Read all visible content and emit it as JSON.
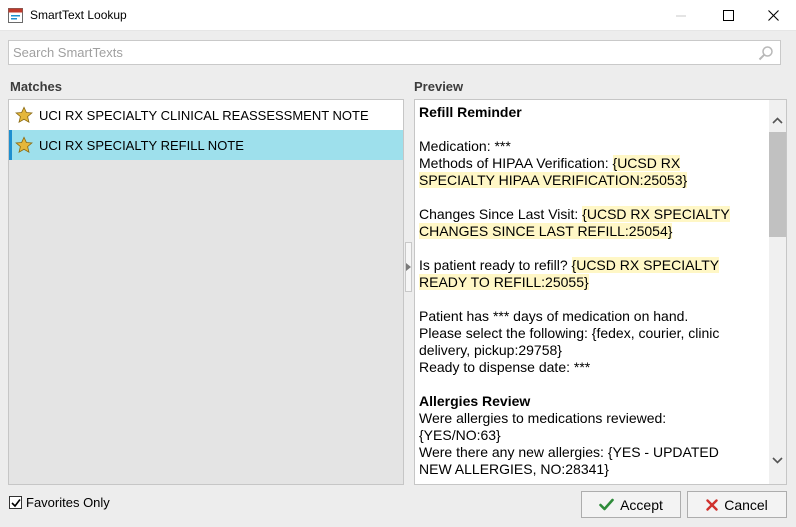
{
  "window": {
    "title": "SmartText Lookup"
  },
  "search": {
    "placeholder": "Search SmartTexts",
    "value": ""
  },
  "matches": {
    "label": "Matches",
    "items": [
      {
        "label": "UCI RX SPECIALTY CLINICAL REASSESSMENT NOTE",
        "selected": false,
        "favorite": true
      },
      {
        "label": "UCI RX SPECIALTY REFILL NOTE",
        "selected": true,
        "favorite": true
      }
    ]
  },
  "preview": {
    "label": "Preview",
    "heading": "Refill Reminder",
    "medication": "Medication: ***",
    "hipaa_prefix": "Methods of HIPAA Verification: ",
    "hipaa_field_line1": "{UCSD RX",
    "hipaa_field_line2": "SPECIALTY HIPAA VERIFICATION:25053}",
    "changes_prefix": "Changes Since Last Visit: ",
    "changes_field_line1": "{UCSD RX SPECIALTY",
    "changes_field_line2": "CHANGES SINCE LAST REFILL:25054}",
    "ready_prefix": "Is patient ready to refill? ",
    "ready_field_line1": "{UCSD RX SPECIALTY",
    "ready_field_line2": "READY TO REFILL:25055}",
    "days_line": "Patient has *** days of medication on hand.",
    "select_line1": "Please select the following: {fedex, courier, clinic",
    "select_line2": "delivery, pickup:29758}",
    "dispense_line": "Ready to dispense date: ***",
    "allergies_heading": "Allergies Review",
    "allergies_line1": "Were allergies to medications reviewed:",
    "allergies_line2": "{YES/NO:63}",
    "new_allergies_line1": "Were there any new allergies: {YES - UPDATED",
    "new_allergies_line2": "NEW ALLERGIES, NO:28341}"
  },
  "footer": {
    "favorites_label": "Favorites Only",
    "favorites_checked": true,
    "accept_label": "Accept",
    "cancel_label": "Cancel"
  },
  "colors": {
    "selected_row": "#9ee0ec",
    "smartlink_highlight": "#fff7c6",
    "accept_check": "#2e8b3a",
    "cancel_x": "#d0312d",
    "star": "#e5b73b"
  }
}
